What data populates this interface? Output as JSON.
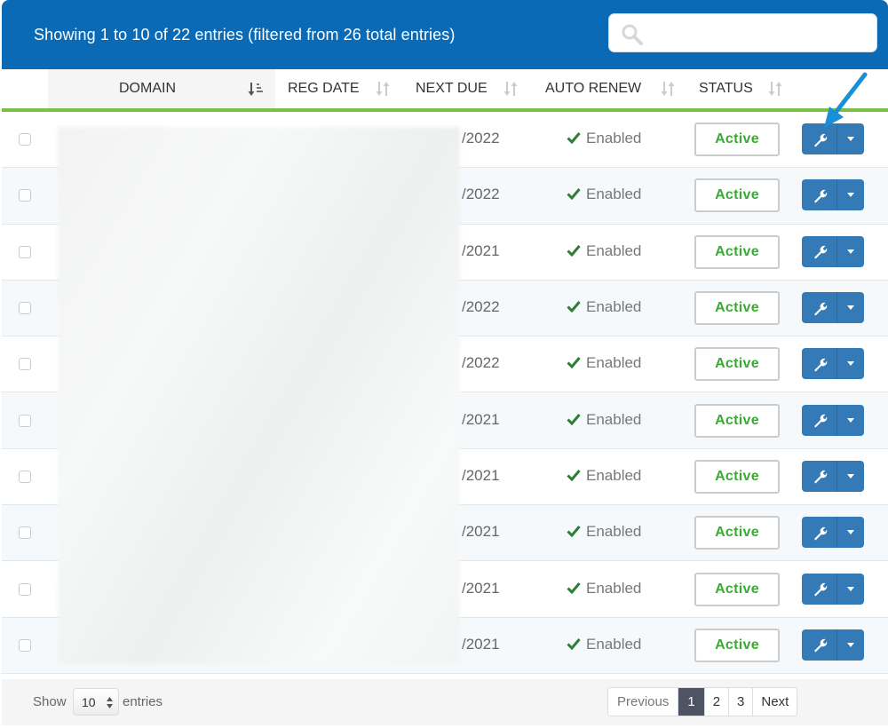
{
  "header": {
    "info_text": "Showing 1 to 10 of 22 entries (filtered from 26 total entries)",
    "search": {
      "placeholder": "",
      "value": "",
      "icon": "search-icon"
    }
  },
  "colors": {
    "header_bg": "#0a6ab5",
    "accent_rule": "#7ac143",
    "status_active": "#3aaa35",
    "action_button": "#337ab7",
    "check_green": "#2e7d32",
    "pagination_current": "#4e5463"
  },
  "columns": [
    {
      "label": "DOMAIN",
      "sort": "ascending"
    },
    {
      "label": "REG DATE",
      "sort": "none"
    },
    {
      "label": "NEXT DUE",
      "sort": "none"
    },
    {
      "label": "AUTO RENEW",
      "sort": "none"
    },
    {
      "label": "STATUS",
      "sort": "none"
    }
  ],
  "rows": [
    {
      "next_due": "/2022",
      "auto_renew": "Enabled",
      "status": "Active"
    },
    {
      "next_due": "/2022",
      "auto_renew": "Enabled",
      "status": "Active"
    },
    {
      "next_due": "/2021",
      "auto_renew": "Enabled",
      "status": "Active"
    },
    {
      "next_due": "/2022",
      "auto_renew": "Enabled",
      "status": "Active"
    },
    {
      "next_due": "/2022",
      "auto_renew": "Enabled",
      "status": "Active"
    },
    {
      "next_due": "/2021",
      "auto_renew": "Enabled",
      "status": "Active"
    },
    {
      "next_due": "/2021",
      "auto_renew": "Enabled",
      "status": "Active"
    },
    {
      "next_due": "/2021",
      "auto_renew": "Enabled",
      "status": "Active"
    },
    {
      "next_due": "/2021",
      "auto_renew": "Enabled",
      "status": "Active"
    },
    {
      "next_due": "/2021",
      "auto_renew": "Enabled",
      "status": "Active"
    }
  ],
  "footer": {
    "show_label": "Show",
    "page_length": "10",
    "entries_label": "entries",
    "pagination": {
      "previous": "Previous",
      "pages": [
        "1",
        "2",
        "3"
      ],
      "current": "1",
      "next": "Next"
    }
  }
}
